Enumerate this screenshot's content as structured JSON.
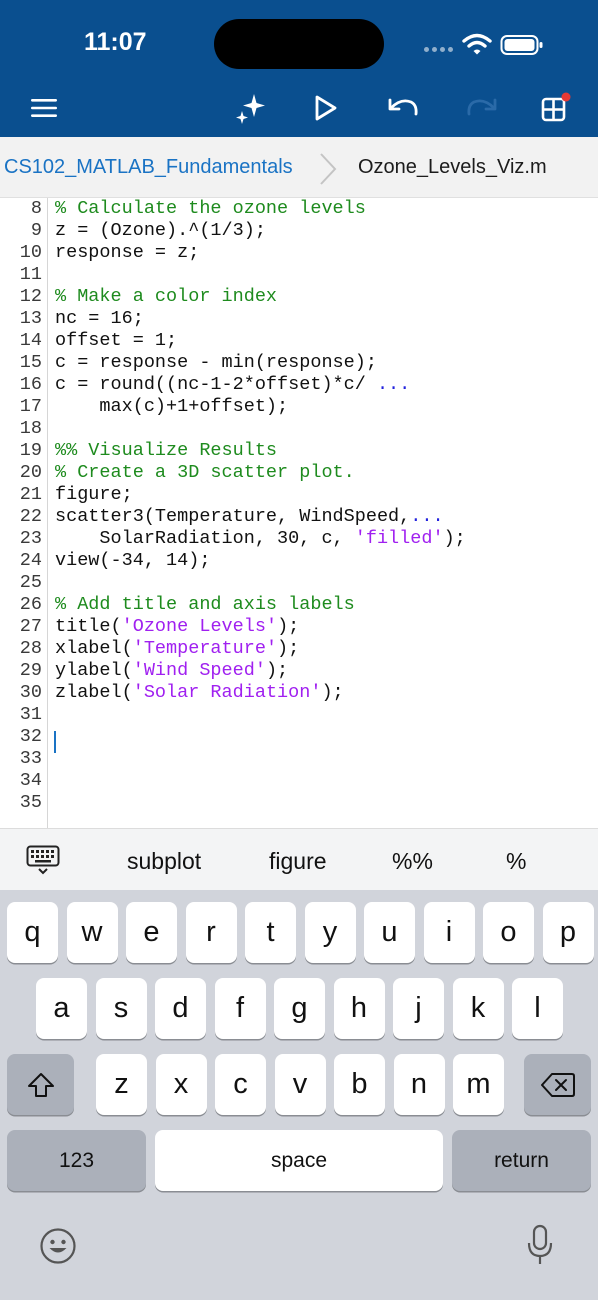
{
  "status": {
    "time": "11:07"
  },
  "toolbar": {
    "menu_icon": "hamburger-menu-icon",
    "ai_icon": "sparkle-icon",
    "run_icon": "play-icon",
    "undo_icon": "undo-icon",
    "redo_icon": "redo-icon",
    "apps_icon": "grid-apps-icon",
    "accent": "#0a4f8f",
    "notification_dot": "#e53935"
  },
  "breadcrumb": {
    "parent": "CS102_MATLAB_Fundamentals",
    "current": "Ozone_Levels_Viz.m"
  },
  "editor": {
    "colors": {
      "comment": "#1e8b1e",
      "string": "#a020f0",
      "continuation": "#2222dd"
    },
    "lines": [
      {
        "n": "8",
        "segs": [
          {
            "t": "% Calculate the ozone levels",
            "k": "comment"
          }
        ]
      },
      {
        "n": "9",
        "segs": [
          {
            "t": "z = (Ozone).^(1/3);",
            "k": "code"
          }
        ]
      },
      {
        "n": "10",
        "segs": [
          {
            "t": "response = z;",
            "k": "code"
          }
        ]
      },
      {
        "n": "11",
        "segs": []
      },
      {
        "n": "12",
        "segs": [
          {
            "t": "% Make a color index",
            "k": "comment"
          }
        ]
      },
      {
        "n": "13",
        "segs": [
          {
            "t": "nc = 16;",
            "k": "code"
          }
        ]
      },
      {
        "n": "14",
        "segs": [
          {
            "t": "offset = 1;",
            "k": "code"
          }
        ]
      },
      {
        "n": "15",
        "segs": [
          {
            "t": "c = response - min(response);",
            "k": "code"
          }
        ]
      },
      {
        "n": "16",
        "segs": [
          {
            "t": "c = round((nc-1-2*offset)*c/ ",
            "k": "code"
          },
          {
            "t": "...",
            "k": "cont"
          }
        ]
      },
      {
        "n": "17",
        "segs": [
          {
            "t": "    max(c)+1+offset);",
            "k": "code"
          }
        ]
      },
      {
        "n": "18",
        "segs": []
      },
      {
        "n": "19",
        "segs": [
          {
            "t": "%% Visualize Results",
            "k": "comment"
          }
        ]
      },
      {
        "n": "20",
        "segs": [
          {
            "t": "% Create a 3D scatter plot.",
            "k": "comment"
          }
        ]
      },
      {
        "n": "21",
        "segs": [
          {
            "t": "figure;",
            "k": "code"
          }
        ]
      },
      {
        "n": "22",
        "segs": [
          {
            "t": "scatter3(Temperature, WindSpeed,",
            "k": "code"
          },
          {
            "t": "...",
            "k": "cont"
          }
        ]
      },
      {
        "n": "23",
        "segs": [
          {
            "t": "    SolarRadiation, 30, c, ",
            "k": "code"
          },
          {
            "t": "'filled'",
            "k": "string"
          },
          {
            "t": ");",
            "k": "code"
          }
        ]
      },
      {
        "n": "24",
        "segs": [
          {
            "t": "view(-34, 14);",
            "k": "code"
          }
        ]
      },
      {
        "n": "25",
        "segs": []
      },
      {
        "n": "26",
        "segs": [
          {
            "t": "% Add title and axis labels",
            "k": "comment"
          }
        ]
      },
      {
        "n": "27",
        "segs": [
          {
            "t": "title(",
            "k": "code"
          },
          {
            "t": "'Ozone Levels'",
            "k": "string"
          },
          {
            "t": ");",
            "k": "code"
          }
        ]
      },
      {
        "n": "28",
        "segs": [
          {
            "t": "xlabel(",
            "k": "code"
          },
          {
            "t": "'Temperature'",
            "k": "string"
          },
          {
            "t": ");",
            "k": "code"
          }
        ]
      },
      {
        "n": "29",
        "segs": [
          {
            "t": "ylabel(",
            "k": "code"
          },
          {
            "t": "'Wind Speed'",
            "k": "string"
          },
          {
            "t": ");",
            "k": "code"
          }
        ]
      },
      {
        "n": "30",
        "segs": [
          {
            "t": "zlabel(",
            "k": "code"
          },
          {
            "t": "'Solar Radiation'",
            "k": "string"
          },
          {
            "t": ");",
            "k": "code"
          }
        ]
      },
      {
        "n": "31",
        "segs": []
      },
      {
        "n": "32",
        "segs": []
      },
      {
        "n": "33",
        "segs": []
      },
      {
        "n": "34",
        "segs": []
      },
      {
        "n": "35",
        "segs": []
      }
    ]
  },
  "suggestions": {
    "keyboard_icon": "keyboard-icon",
    "items": [
      "subplot",
      "figure",
      "%%",
      "%"
    ]
  },
  "keyboard": {
    "row1": [
      "q",
      "w",
      "e",
      "r",
      "t",
      "y",
      "u",
      "i",
      "o",
      "p"
    ],
    "row2": [
      "a",
      "s",
      "d",
      "f",
      "g",
      "h",
      "j",
      "k",
      "l"
    ],
    "row3": [
      "z",
      "x",
      "c",
      "v",
      "b",
      "n",
      "m"
    ],
    "shift_icon": "shift-icon",
    "delete_icon": "backspace-icon",
    "numbers_label": "123",
    "space_label": "space",
    "return_label": "return",
    "emoji_icon": "emoji-icon",
    "mic_icon": "microphone-icon"
  }
}
